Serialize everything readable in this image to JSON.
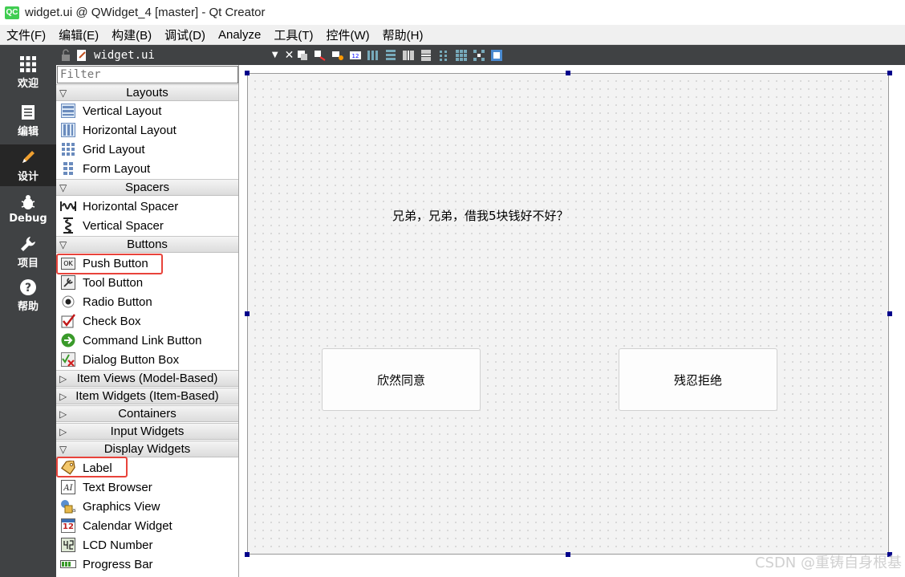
{
  "window": {
    "title": "widget.ui @ QWidget_4 [master] - Qt Creator",
    "logo_text": "QC"
  },
  "menu": [
    "文件(F)",
    "编辑(E)",
    "构建(B)",
    "调试(D)",
    "Analyze",
    "工具(T)",
    "控件(W)",
    "帮助(H)"
  ],
  "modes": [
    {
      "label": "欢迎",
      "icon": "grid-icon"
    },
    {
      "label": "编辑",
      "icon": "document-icon"
    },
    {
      "label": "设计",
      "icon": "pencil-icon",
      "active": true
    },
    {
      "label": "Debug",
      "icon": "bug-icon"
    },
    {
      "label": "项目",
      "icon": "wrench-icon"
    },
    {
      "label": "帮助",
      "icon": "help-icon"
    }
  ],
  "editor": {
    "file_name": "widget.ui"
  },
  "widgetbox": {
    "filter_placeholder": "Filter",
    "categories": {
      "layouts": "Layouts",
      "spacers": "Spacers",
      "buttons": "Buttons",
      "item_views": "Item Views (Model-Based)",
      "item_widgets": "Item Widgets (Item-Based)",
      "containers": "Containers",
      "input_widgets": "Input Widgets",
      "display_widgets": "Display Widgets"
    },
    "layouts": [
      "Vertical Layout",
      "Horizontal Layout",
      "Grid Layout",
      "Form Layout"
    ],
    "spacers": [
      "Horizontal Spacer",
      "Vertical Spacer"
    ],
    "buttons": [
      "Push Button",
      "Tool Button",
      "Radio Button",
      "Check Box",
      "Command Link Button",
      "Dialog Button Box"
    ],
    "display": [
      "Label",
      "Text Browser",
      "Graphics View",
      "Calendar Widget",
      "LCD Number",
      "Progress Bar"
    ],
    "calendar_day": "12",
    "pushbutton_icon_text": "OK"
  },
  "form": {
    "label_text": "兄弟，兄弟，借我5块钱好不好？",
    "accept_button": "欣然同意",
    "reject_button": "残忍拒绝"
  },
  "watermark": "CSDN @重铸自身根基",
  "colors": {
    "highlight": "#e8433b",
    "sidebar": "#404244",
    "handle": "#00008b"
  }
}
